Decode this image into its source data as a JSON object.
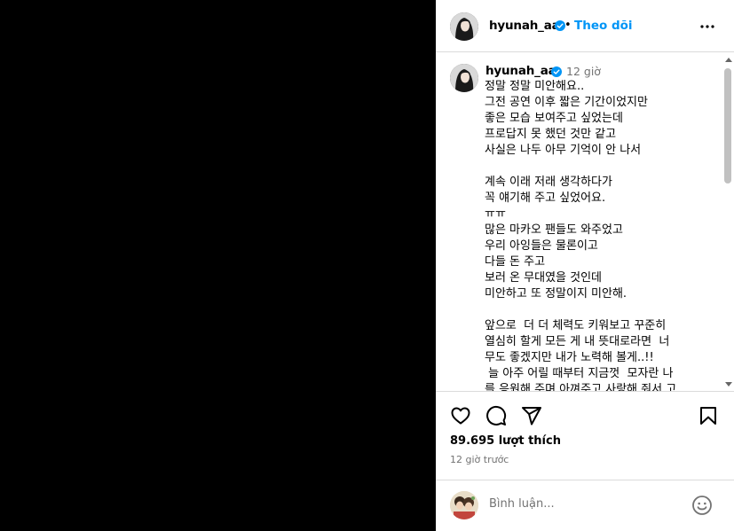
{
  "post": {
    "username": "hyunah_aa",
    "follow_label": "Theo dõi",
    "separator": "•",
    "caption_time": "12 giờ",
    "caption": "정말 정말 미안해요..\n그전 공연 이후 짧은 기간이었지만\n좋은 모습 보여주고 싶었는데\n프로답지 못 했던 것만 같고\n사실은 나두 아무 기억이 안 나서\n\n계속 이래 저래 생각하다가\n꼭 얘기해 주고 싶었어요.\nㅠㅠ\n많은 마카오 팬들도 와주었고\n우리 아잉들은 물론이고\n다들 돈 주고\n보러 온 무대였을 것인데\n미안하고 또 정말이지 미안해.\n\n앞으로  더 더 체력도 키워보고 꾸준히\n열심히 할게 모든 게 내 뜻대로라면  너\n무도 좋겠지만 내가 노력해 볼게..!!\n 늘 아주 어릴 때부터 지금껏  모자란 나\n를 응원해 주며 아껴주고 사랑해 줘서 고\n맙고 미안해요",
    "likes": "89.695 lượt thích",
    "posted_time": "12 giờ trước"
  },
  "comment_box": {
    "placeholder": "Bình luận..."
  },
  "icons": {
    "more": "more-options-icon",
    "like": "heart-icon",
    "comment": "comment-icon",
    "share": "share-icon",
    "save": "bookmark-icon",
    "verified": "verified-badge-icon",
    "emoji": "emoji-icon"
  },
  "colors": {
    "accent": "#0095f6",
    "secondary_text": "#737373",
    "border": "#dbdbdb",
    "media_bg": "#000000"
  }
}
